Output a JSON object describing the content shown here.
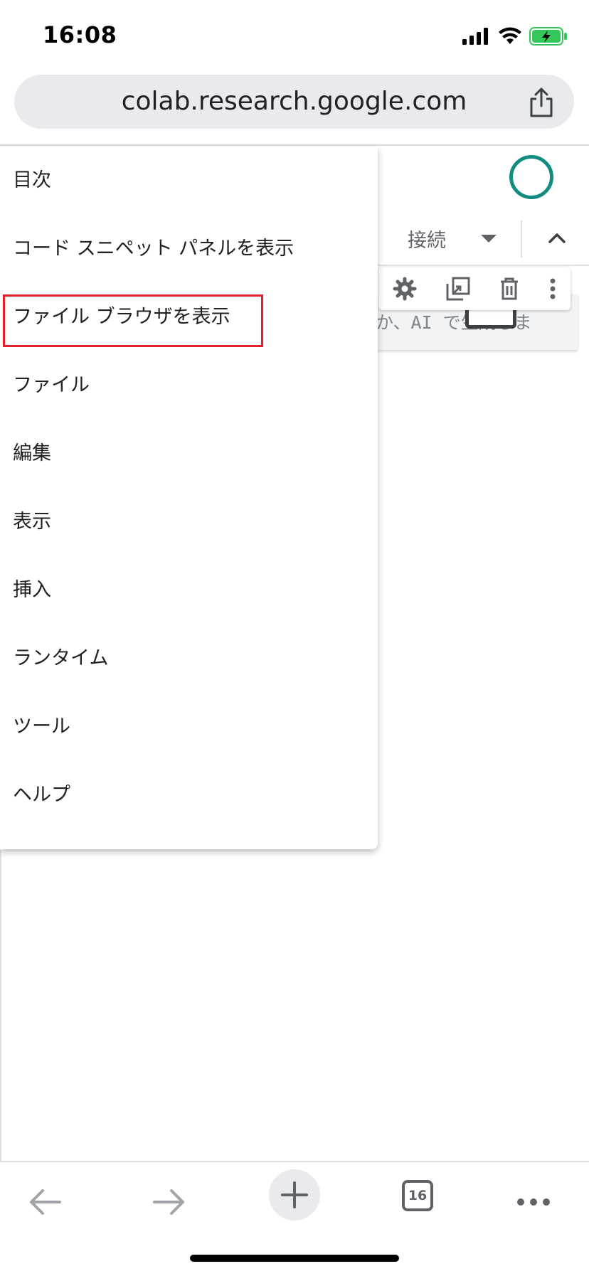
{
  "status_bar": {
    "time": "16:08",
    "icons": [
      "signal-icon",
      "wifi-icon",
      "battery-charging-icon"
    ],
    "battery_color": "#34c759"
  },
  "browser": {
    "url": "colab.research.google.com",
    "share_icon": "share-icon"
  },
  "notebook": {
    "connect_label": "接続",
    "cell_placeholder": "か、AI で生成しま",
    "cell_toolbar_icons": [
      "gear-icon",
      "mirror-cell-icon",
      "trash-icon",
      "more-vert-icon"
    ],
    "avatar_color": "#128c7e"
  },
  "menu": {
    "items": [
      {
        "label": "目次"
      },
      {
        "label": "コード スニペット パネルを表示"
      },
      {
        "label": "ファイル ブラウザを表示",
        "highlighted": true
      },
      {
        "label": "ファイル"
      },
      {
        "label": "編集"
      },
      {
        "label": "表示"
      },
      {
        "label": "挿入"
      },
      {
        "label": "ランタイム"
      },
      {
        "label": "ツール"
      },
      {
        "label": "ヘルプ"
      }
    ],
    "highlight_color": "#e0212b"
  },
  "bottom_toolbar": {
    "icons": [
      "back-arrow-icon",
      "forward-arrow-icon",
      "new-tab-plus-icon",
      "tabs-icon",
      "more-horiz-icon"
    ],
    "tab_count": "16"
  }
}
